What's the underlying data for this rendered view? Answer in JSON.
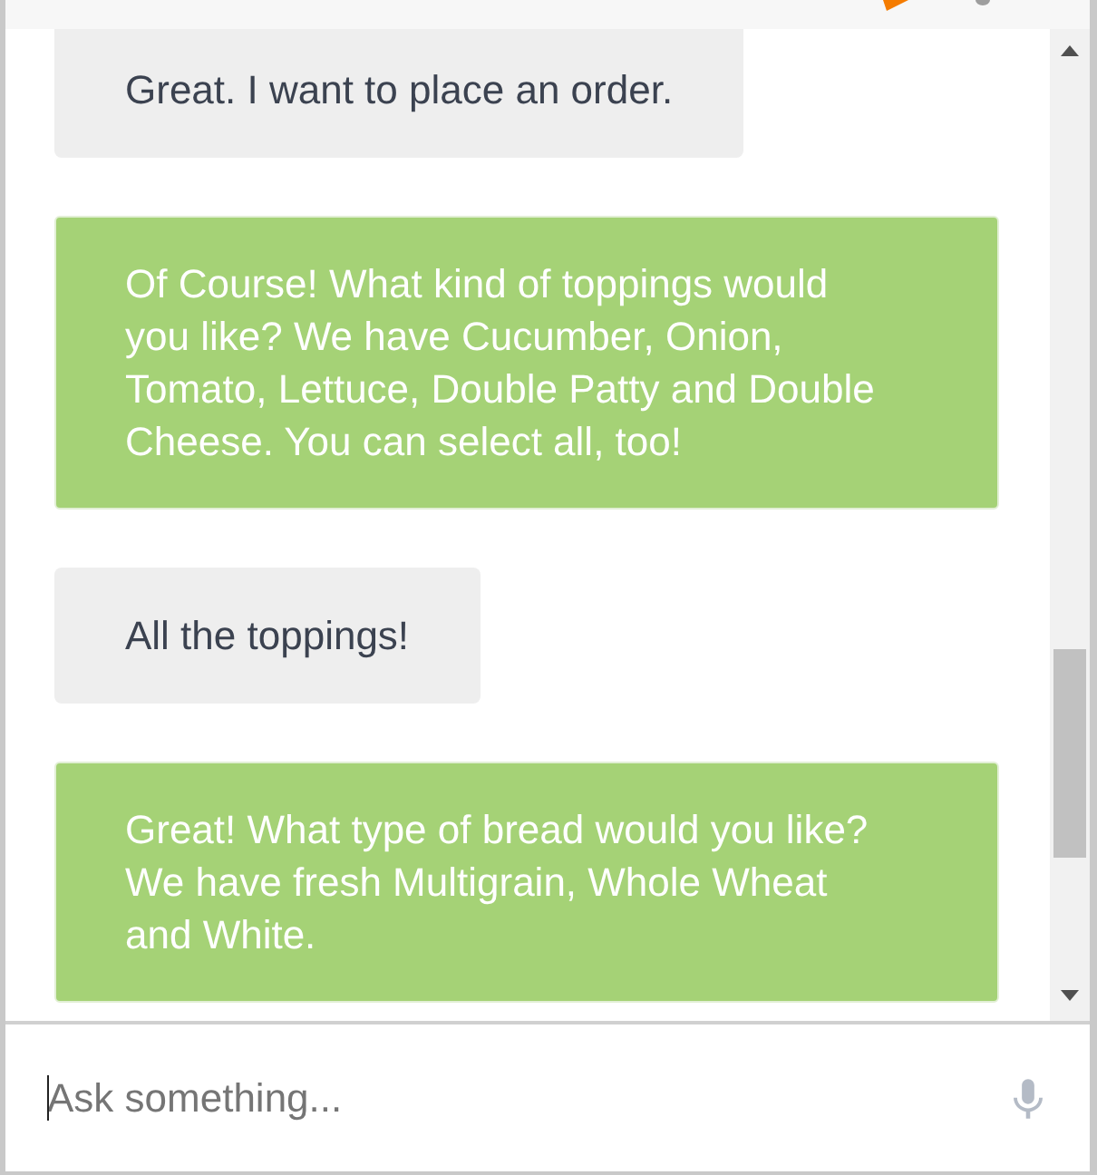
{
  "messages": [
    {
      "kind": "user",
      "text": "Great. I want to place an order."
    },
    {
      "kind": "bot",
      "text": "Of Course! What kind of toppings would you like? We have Cucumber, Onion, Tomato, Lettuce, Double Patty and Double Cheese. You can select all, too!"
    },
    {
      "kind": "user",
      "text": "All the toppings!"
    },
    {
      "kind": "bot",
      "text": "Great! What type of bread would you like? We have fresh Multigrain, Whole Wheat and White."
    }
  ],
  "composer": {
    "placeholder": "Ask something..."
  }
}
